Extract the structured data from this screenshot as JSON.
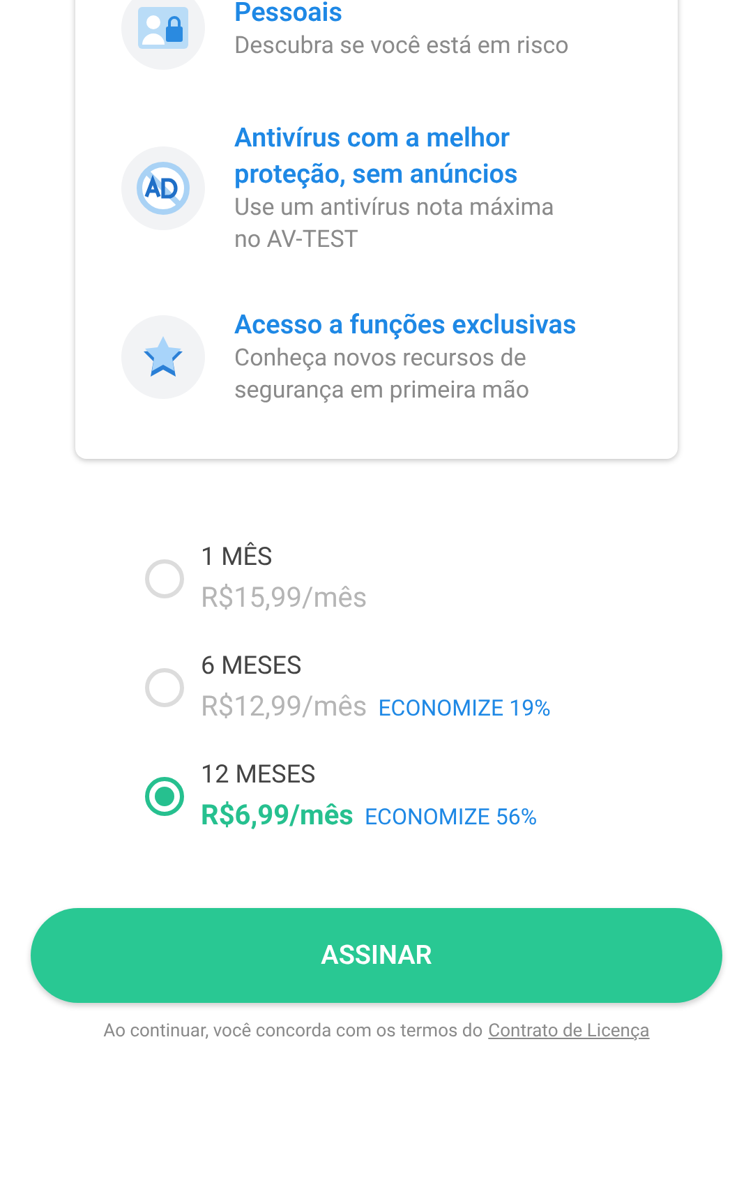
{
  "features": [
    {
      "kind": "identity",
      "title": "Pessoais",
      "description": "Descubra se você está em risco"
    },
    {
      "kind": "noads",
      "title": "Antivírus com a melhor proteção, sem anúncios",
      "description": "Use um antivírus nota máxima no AV-TEST"
    },
    {
      "kind": "star",
      "title": "Acesso a funções exclusivas",
      "description": "Conheça novos recursos de segurança em primeira mão"
    }
  ],
  "plans": [
    {
      "period": "1 MÊS",
      "price": "R$15,99/mês",
      "selected": false
    },
    {
      "period": "6 MESES",
      "price": "R$12,99/mês",
      "saving": "ECONOMIZE 19%",
      "selected": false
    },
    {
      "period": "12 MESES",
      "price": "R$6,99/mês",
      "saving": "ECONOMIZE 56%",
      "selected": true
    }
  ],
  "subscribe_button": "ASSINAR",
  "footer": {
    "text": "Ao continuar, você concorda com os termos do",
    "link": "Contrato de Licença"
  }
}
